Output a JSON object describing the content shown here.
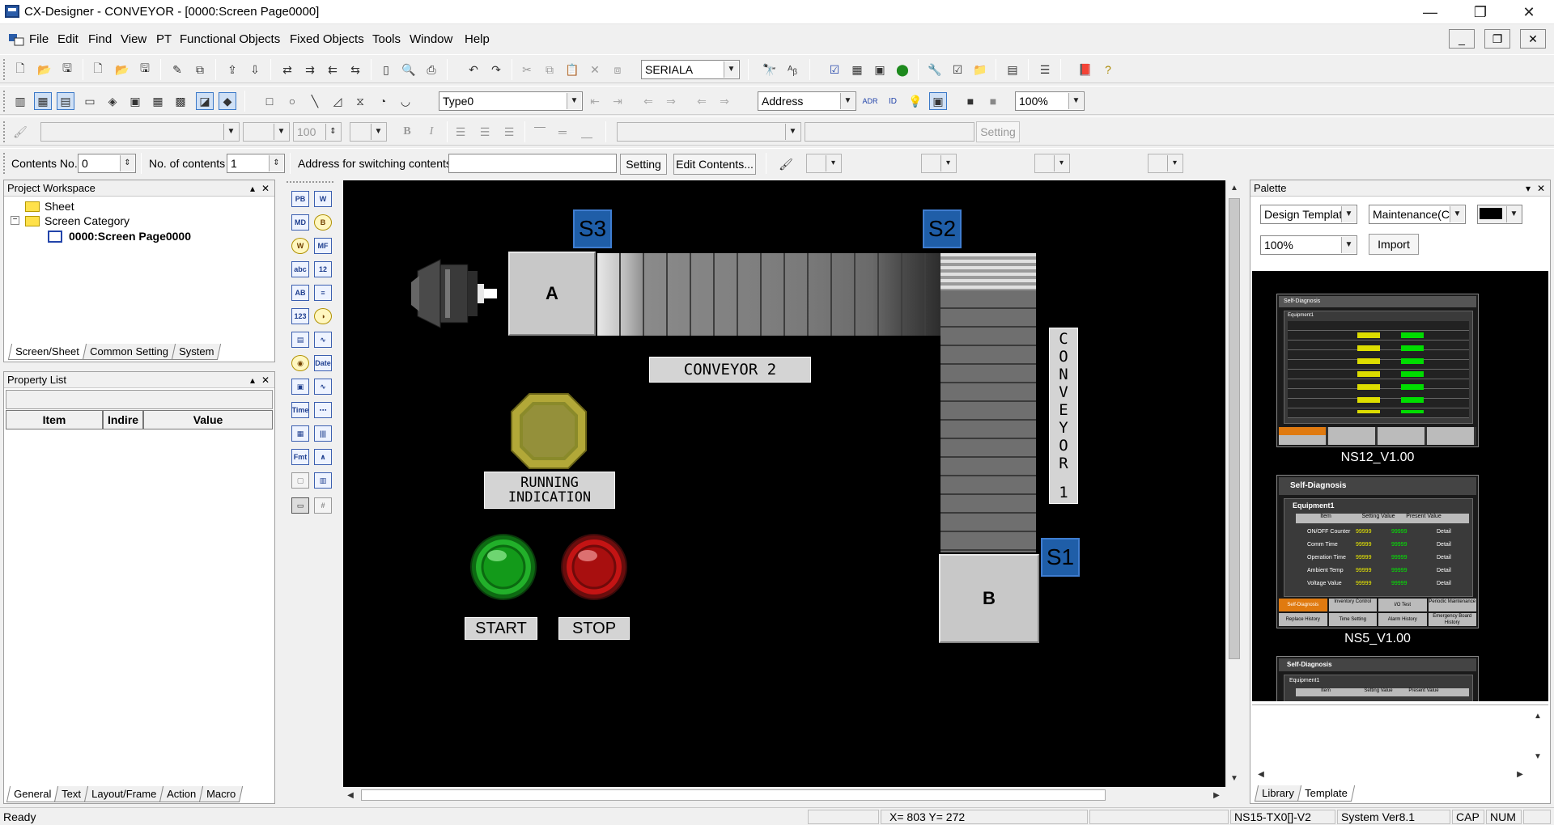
{
  "window": {
    "title": "CX-Designer - CONVEYOR - [0000:Screen Page0000]",
    "controls": {
      "minimize": "—",
      "restore": "❐",
      "close": "✕"
    }
  },
  "menu": [
    "File",
    "Edit",
    "Find",
    "View",
    "PT",
    "Functional Objects",
    "Fixed Objects",
    "Tools",
    "Window",
    "Help"
  ],
  "toolbar1": {
    "comm_combo": "SERIALA"
  },
  "toolbar2": {
    "type_combo": "Type0",
    "address_combo": "Address",
    "zoom_combo": "100%"
  },
  "toolbar3": {
    "size_value": "100",
    "setting_label": "Setting",
    "bold": "B",
    "italic": "I"
  },
  "contents_bar": {
    "contents_no_label": "Contents No.",
    "contents_no_value": "0",
    "num_contents_label": "No. of contents",
    "num_contents_value": "1",
    "address_label": "Address for switching contents",
    "address_value": "",
    "setting_button": "Setting",
    "edit_contents_button": "Edit Contents..."
  },
  "project_workspace": {
    "title": "Project Workspace",
    "tree": [
      {
        "label": "Sheet",
        "type": "folder"
      },
      {
        "label": "Screen Category",
        "type": "folder"
      },
      {
        "label": "0000:Screen Page0000",
        "type": "screen"
      }
    ],
    "tabs": [
      "Screen/Sheet",
      "Common Setting",
      "System"
    ]
  },
  "property_list": {
    "title": "Property List",
    "columns": [
      "Item",
      "Indire",
      "Value"
    ],
    "tabs": [
      "General",
      "Text",
      "Layout/Frame",
      "Action",
      "Macro"
    ]
  },
  "toolbox": [
    [
      "PB",
      "W"
    ],
    [
      "MD",
      "B"
    ],
    [
      "W",
      "MF"
    ],
    [
      "abc",
      "12"
    ],
    [
      "AB",
      "≡"
    ],
    [
      "123",
      "◑"
    ],
    [
      "▤",
      "∿"
    ],
    [
      "◉",
      "Date"
    ],
    [
      "▣",
      "∿"
    ],
    [
      "Time",
      "⋯"
    ],
    [
      "▦",
      "|||"
    ],
    [
      "Fmt",
      "∧"
    ],
    [
      "▢",
      "▥"
    ],
    [
      "▭",
      "#"
    ]
  ],
  "screen": {
    "sensors": {
      "s1": "S1",
      "s2": "S2",
      "s3": "S3"
    },
    "box_a": "A",
    "box_b": "B",
    "conveyor2_label": "CONVEYOR 2",
    "conveyor1_label": [
      "C",
      "O",
      "N",
      "V",
      "E",
      "Y",
      "O",
      "R",
      "",
      "1"
    ],
    "running_label": [
      "RUNNING",
      "INDICATION"
    ],
    "start_label": "START",
    "stop_label": "STOP",
    "colors": {
      "background": "#000000",
      "sensor": "#1f5ea8",
      "start_button": "#22b02a",
      "stop_button": "#c41414",
      "lamp": "#8a8a2a"
    }
  },
  "palette": {
    "title": "Palette",
    "design_combo": "Design Template",
    "maintenance_combo": "Maintenance(C",
    "zoom_combo": "100%",
    "import_button": "Import",
    "templates": [
      {
        "name": "NS12_V1.00",
        "header": "Self-Diagnosis",
        "equipment": "Equipment1"
      },
      {
        "name": "NS5_V1.00",
        "header": "Self-Diagnosis",
        "equipment": "Equipment1",
        "rows": [
          "ON/OFF Counter",
          "Comm Time",
          "Operation Time",
          "Ambient Temp",
          "Voltage Value"
        ],
        "value": "99999",
        "buttons": [
          "Self-Diagnosis",
          "Inventory Control",
          "I/O Test",
          "Periodic Maintenance"
        ],
        "buttons2": [
          "Replace History",
          "Time Setting",
          "Alarm History",
          "Emergency Board History"
        ],
        "cols": [
          "Item",
          "Setting Value",
          "Present Value"
        ],
        "detail": "Detail"
      },
      {
        "name": "",
        "header": "Self-Diagnosis",
        "equipment": "Equipment1",
        "cols": [
          "Item",
          "Setting Value",
          "Present Value"
        ]
      }
    ],
    "tabs": [
      "Library",
      "Template"
    ]
  },
  "status": {
    "ready": "Ready",
    "coords": "X= 803 Y= 272",
    "pt_model": "NS15-TX0[]-V2",
    "system_ver": "System Ver8.1",
    "cap": "CAP",
    "num": "NUM"
  }
}
